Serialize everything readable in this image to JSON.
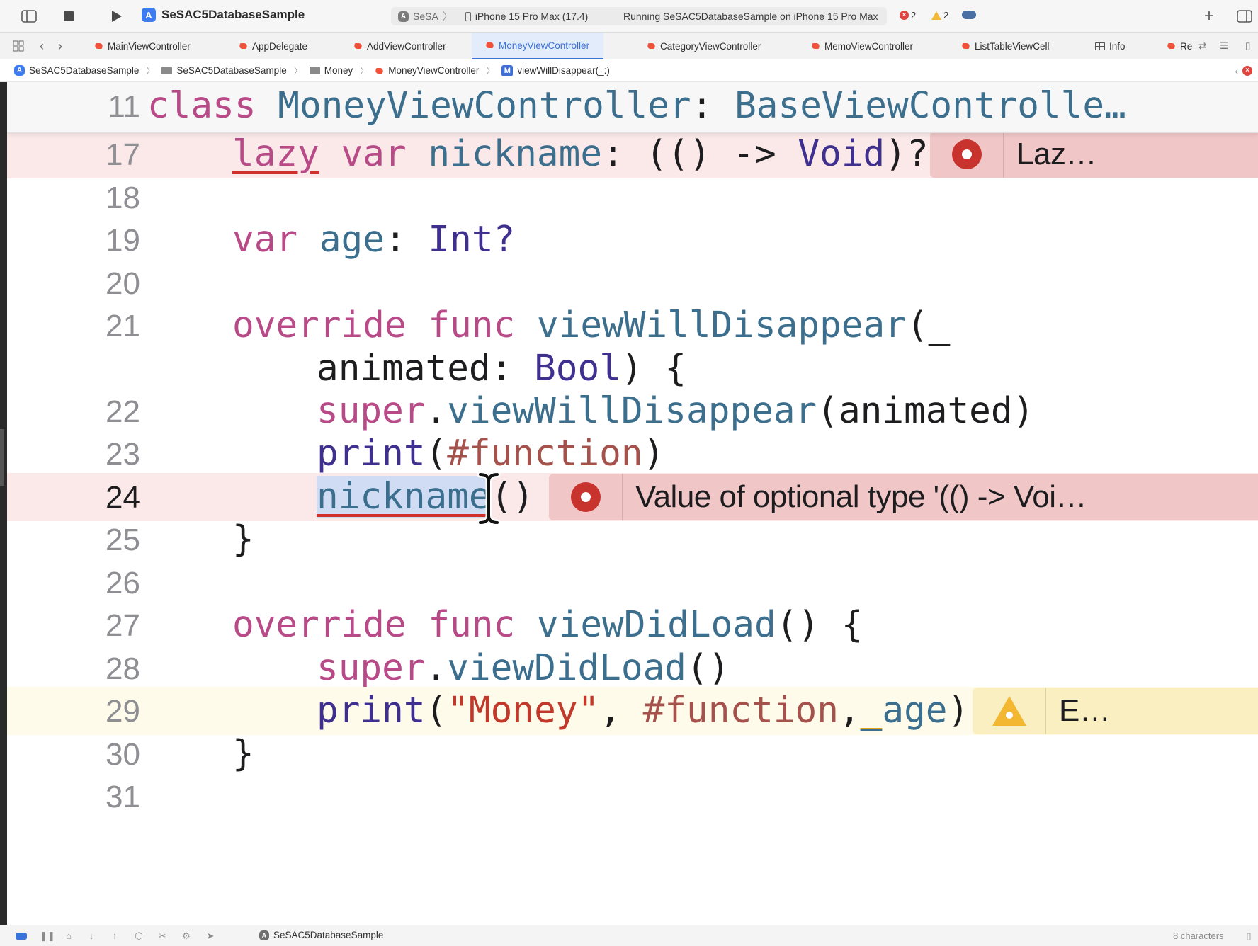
{
  "toolbar": {
    "scheme": "SeSAC5DatabaseSample",
    "scheme_short": "SeSA",
    "device": "iPhone 15 Pro Max (17.4)",
    "status": "Running SeSAC5DatabaseSample on iPhone 15 Pro Max",
    "errors": "2",
    "warnings": "2"
  },
  "tabs": [
    {
      "label": "MainViewController",
      "active": false
    },
    {
      "label": "AppDelegate",
      "active": false
    },
    {
      "label": "AddViewController",
      "active": false
    },
    {
      "label": "MoneyViewController",
      "active": true
    },
    {
      "label": "CategoryViewController",
      "active": false
    },
    {
      "label": "MemoViewController",
      "active": false
    },
    {
      "label": "ListTableViewCell",
      "active": false
    },
    {
      "label": "Info",
      "active": false
    },
    {
      "label": "Re",
      "active": false
    }
  ],
  "breadcrumb": [
    "SeSAC5DatabaseSample",
    "SeSAC5DatabaseSample",
    "Money",
    "MoneyViewController",
    "viewWillDisappear(_:)"
  ],
  "editor": {
    "sticky": {
      "line": "11",
      "kw": "class",
      "name": "MoneyViewController",
      "colon": ":",
      "super": "BaseViewControlle…"
    },
    "lines": {
      "l17": {
        "num": "17",
        "lazy": "lazy",
        "var": "var",
        "name": "nickname",
        "colon": ":",
        "type_open": "(() -> ",
        "void": "Void",
        "type_close": ")?"
      },
      "l18": {
        "num": "18"
      },
      "l19": {
        "num": "19",
        "var": "var",
        "name": "age",
        "colon": ":",
        "type": "Int?"
      },
      "l20": {
        "num": "20"
      },
      "l21": {
        "num": "21",
        "override": "override",
        "func": "func",
        "name": "viewWillDisappear",
        "paren": "(_"
      },
      "l21b": {
        "arg": "animated",
        "colon": ":",
        "type": "Bool",
        "tail": ") {"
      },
      "l22": {
        "num": "22",
        "super": "super",
        "dot": ".",
        "call": "viewWillDisappear",
        "args": "(animated)"
      },
      "l23": {
        "num": "23",
        "print": "print",
        "open": "(",
        "dir": "#function",
        "close": ")"
      },
      "l24": {
        "num": "24",
        "call": "nickname",
        "parens": "()"
      },
      "l25": {
        "num": "25",
        "brace": "}"
      },
      "l26": {
        "num": "26"
      },
      "l27": {
        "num": "27",
        "override": "override",
        "func": "func",
        "name": "viewDidLoad",
        "tail": "() {"
      },
      "l28": {
        "num": "28",
        "super": "super",
        "dot": ".",
        "call": "viewDidLoad",
        "parens": "()"
      },
      "l29": {
        "num": "29",
        "print": "print",
        "open": "(",
        "str": "\"Money\"",
        "comma": ", ",
        "dir": "#function",
        "comma2": ",",
        "u": "_",
        "age": "age",
        "close": ")"
      },
      "l30": {
        "num": "30",
        "brace": "}"
      },
      "l31": {
        "num": "31"
      }
    },
    "issues": {
      "lazy_error": "Laz…",
      "optional_error": "Value of optional type '(() -> Voi…",
      "warning": "E…"
    }
  },
  "statusbar": {
    "target": "SeSAC5DatabaseSample",
    "selection": "8 characters"
  },
  "colors": {
    "error_bg": "#f0c6c7",
    "warning_bg": "#faefc1",
    "keyword": "#b84a88",
    "type": "#3f2f8e",
    "identifier": "#3c6f8e",
    "string": "#c1392b",
    "accent": "#3a73d8"
  }
}
